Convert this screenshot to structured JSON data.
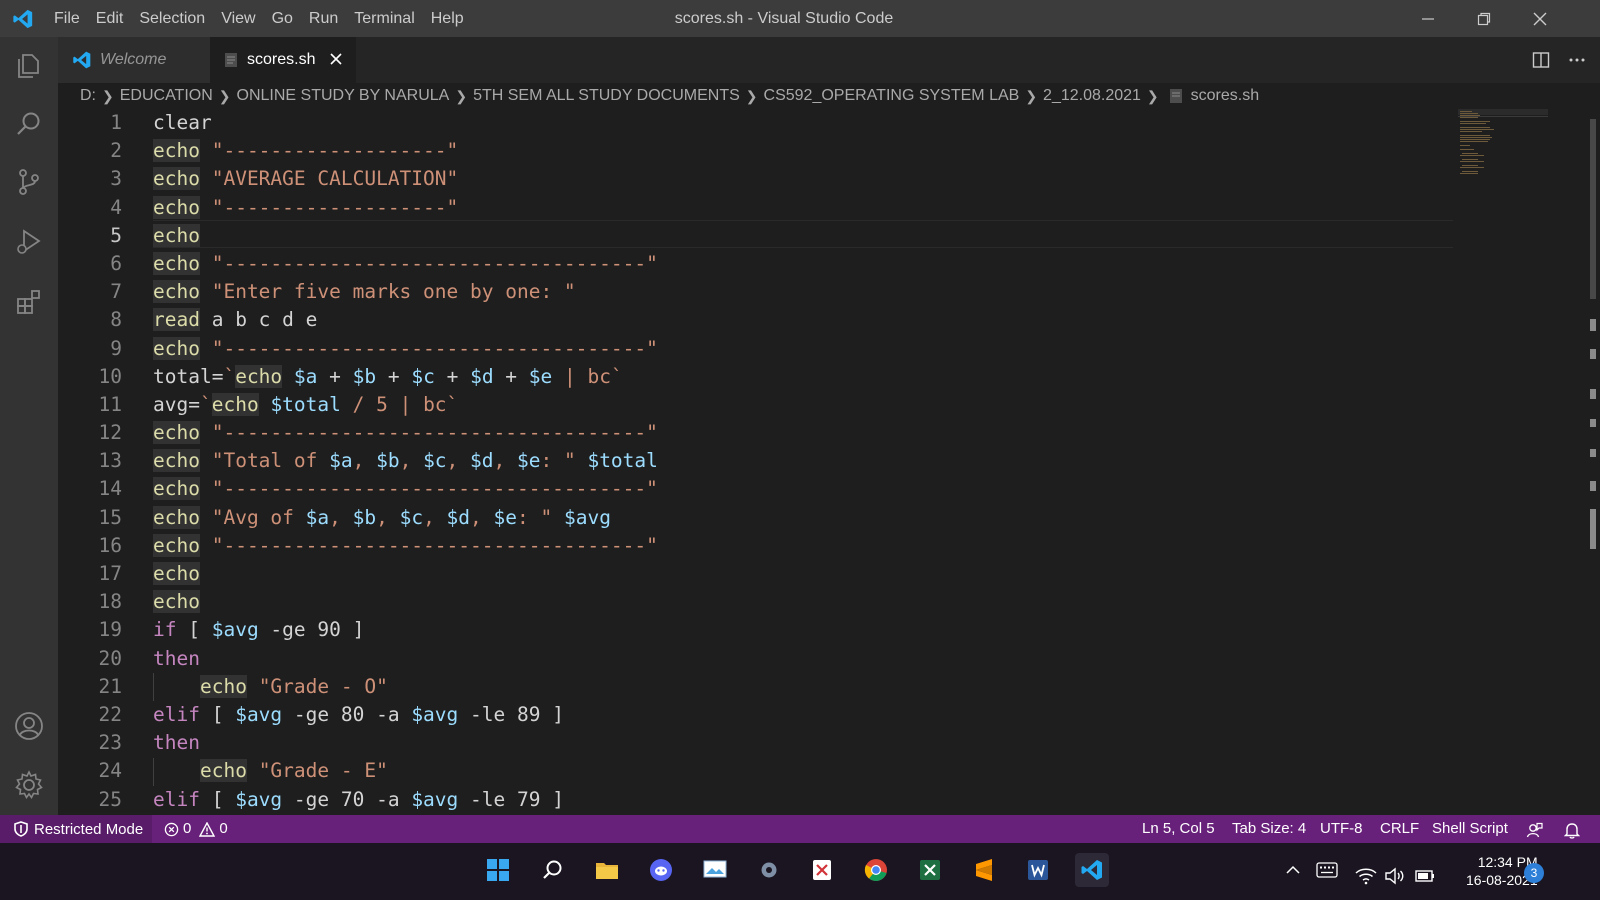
{
  "window": {
    "title": "scores.sh - Visual Studio Code"
  },
  "menu": [
    "File",
    "Edit",
    "Selection",
    "View",
    "Go",
    "Run",
    "Terminal",
    "Help"
  ],
  "tabs": [
    {
      "label": "Welcome",
      "active": false
    },
    {
      "label": "scores.sh",
      "active": true
    }
  ],
  "breadcrumb": [
    "D:",
    "EDUCATION",
    "ONLINE STUDY BY NARULA",
    "5TH SEM ALL STUDY DOCUMENTS",
    "CS592_OPERATING SYSTEM LAB",
    "2_12.08.2021",
    "scores.sh"
  ],
  "editor": {
    "current_line": 5,
    "lines": [
      {
        "n": "1",
        "t": [
          [
            "clear",
            "p"
          ]
        ]
      },
      {
        "n": "2",
        "t": [
          [
            "echo",
            "c"
          ],
          [
            " ",
            "p"
          ],
          [
            "\"-------------------\"",
            "s"
          ]
        ]
      },
      {
        "n": "3",
        "t": [
          [
            "echo",
            "c"
          ],
          [
            " ",
            "p"
          ],
          [
            "\"AVERAGE CALCULATION\"",
            "s"
          ]
        ]
      },
      {
        "n": "4",
        "t": [
          [
            "echo",
            "c"
          ],
          [
            " ",
            "p"
          ],
          [
            "\"-------------------\"",
            "s"
          ]
        ]
      },
      {
        "n": "5",
        "t": [
          [
            "echo",
            "c"
          ]
        ]
      },
      {
        "n": "6",
        "t": [
          [
            "echo",
            "c"
          ],
          [
            " ",
            "p"
          ],
          [
            "\"------------------------------------\"",
            "s"
          ]
        ]
      },
      {
        "n": "7",
        "t": [
          [
            "echo",
            "c"
          ],
          [
            " ",
            "p"
          ],
          [
            "\"Enter five marks one by one: \"",
            "s"
          ]
        ]
      },
      {
        "n": "8",
        "t": [
          [
            "read",
            "c"
          ],
          [
            " a b c d e",
            "p"
          ]
        ]
      },
      {
        "n": "9",
        "t": [
          [
            "echo",
            "c"
          ],
          [
            " ",
            "p"
          ],
          [
            "\"------------------------------------\"",
            "s"
          ]
        ]
      },
      {
        "n": "10",
        "t": [
          [
            "total=",
            "p"
          ],
          [
            "`",
            "s"
          ],
          [
            "echo",
            "c"
          ],
          [
            " ",
            "p"
          ],
          [
            "$a",
            "v"
          ],
          [
            " + ",
            "p"
          ],
          [
            "$b",
            "v"
          ],
          [
            " + ",
            "p"
          ],
          [
            "$c",
            "v"
          ],
          [
            " + ",
            "p"
          ],
          [
            "$d",
            "v"
          ],
          [
            " + ",
            "p"
          ],
          [
            "$e",
            "v"
          ],
          [
            " | bc`",
            "s"
          ]
        ]
      },
      {
        "n": "11",
        "t": [
          [
            "avg=",
            "p"
          ],
          [
            "`",
            "s"
          ],
          [
            "echo",
            "c"
          ],
          [
            " ",
            "p"
          ],
          [
            "$total",
            "v"
          ],
          [
            " / 5 | bc`",
            "s"
          ]
        ]
      },
      {
        "n": "12",
        "t": [
          [
            "echo",
            "c"
          ],
          [
            " ",
            "p"
          ],
          [
            "\"------------------------------------\"",
            "s"
          ]
        ]
      },
      {
        "n": "13",
        "t": [
          [
            "echo",
            "c"
          ],
          [
            " ",
            "p"
          ],
          [
            "\"Total of ",
            "s"
          ],
          [
            "$a",
            "v"
          ],
          [
            ", ",
            "s"
          ],
          [
            "$b",
            "v"
          ],
          [
            ", ",
            "s"
          ],
          [
            "$c",
            "v"
          ],
          [
            ", ",
            "s"
          ],
          [
            "$d",
            "v"
          ],
          [
            ", ",
            "s"
          ],
          [
            "$e",
            "v"
          ],
          [
            ": \" ",
            "s"
          ],
          [
            "$total",
            "v"
          ]
        ]
      },
      {
        "n": "14",
        "t": [
          [
            "echo",
            "c"
          ],
          [
            " ",
            "p"
          ],
          [
            "\"------------------------------------\"",
            "s"
          ]
        ]
      },
      {
        "n": "15",
        "t": [
          [
            "echo",
            "c"
          ],
          [
            " ",
            "p"
          ],
          [
            "\"Avg of ",
            "s"
          ],
          [
            "$a",
            "v"
          ],
          [
            ", ",
            "s"
          ],
          [
            "$b",
            "v"
          ],
          [
            ", ",
            "s"
          ],
          [
            "$c",
            "v"
          ],
          [
            ", ",
            "s"
          ],
          [
            "$d",
            "v"
          ],
          [
            ", ",
            "s"
          ],
          [
            "$e",
            "v"
          ],
          [
            ": \" ",
            "s"
          ],
          [
            "$avg",
            "v"
          ]
        ]
      },
      {
        "n": "16",
        "t": [
          [
            "echo",
            "c"
          ],
          [
            " ",
            "p"
          ],
          [
            "\"------------------------------------\"",
            "s"
          ]
        ]
      },
      {
        "n": "17",
        "t": [
          [
            "echo",
            "c"
          ]
        ]
      },
      {
        "n": "18",
        "t": [
          [
            "echo",
            "c"
          ]
        ]
      },
      {
        "n": "19",
        "t": [
          [
            "if",
            "k"
          ],
          [
            " [ ",
            "p"
          ],
          [
            "$avg",
            "v"
          ],
          [
            " -ge 90 ]",
            "p"
          ]
        ]
      },
      {
        "n": "20",
        "t": [
          [
            "then",
            "k"
          ]
        ]
      },
      {
        "n": "21",
        "t": [
          [
            "    ",
            "p"
          ],
          [
            "echo",
            "c"
          ],
          [
            " ",
            "p"
          ],
          [
            "\"Grade - O\"",
            "s"
          ]
        ]
      },
      {
        "n": "22",
        "t": [
          [
            "elif",
            "k"
          ],
          [
            " [ ",
            "p"
          ],
          [
            "$avg",
            "v"
          ],
          [
            " -ge 80 -a ",
            "p"
          ],
          [
            "$avg",
            "v"
          ],
          [
            " -le 89 ]",
            "p"
          ]
        ]
      },
      {
        "n": "23",
        "t": [
          [
            "then",
            "k"
          ]
        ]
      },
      {
        "n": "24",
        "t": [
          [
            "    ",
            "p"
          ],
          [
            "echo",
            "c"
          ],
          [
            " ",
            "p"
          ],
          [
            "\"Grade - E\"",
            "s"
          ]
        ]
      },
      {
        "n": "25",
        "t": [
          [
            "elif",
            "k"
          ],
          [
            " [ ",
            "p"
          ],
          [
            "$avg",
            "v"
          ],
          [
            " -ge 70 -a ",
            "p"
          ],
          [
            "$avg",
            "v"
          ],
          [
            " -le 79 ]",
            "p"
          ]
        ]
      }
    ]
  },
  "status": {
    "restricted": "Restricted Mode",
    "errors": "0",
    "warnings": "0",
    "position": "Ln 5, Col 5",
    "tab_size": "Tab Size: 4",
    "encoding": "UTF-8",
    "eol": "CRLF",
    "language": "Shell Script"
  },
  "taskbar": {
    "time": "12:34 PM",
    "date": "16-08-2021",
    "notifications": "3"
  },
  "colors": {
    "statusbar": "#68217a",
    "vscode_blue": "#23a9f2",
    "string": "#ce9178",
    "variable": "#9cdcfe",
    "command": "#dcdcaa",
    "keyword": "#c586c0"
  }
}
